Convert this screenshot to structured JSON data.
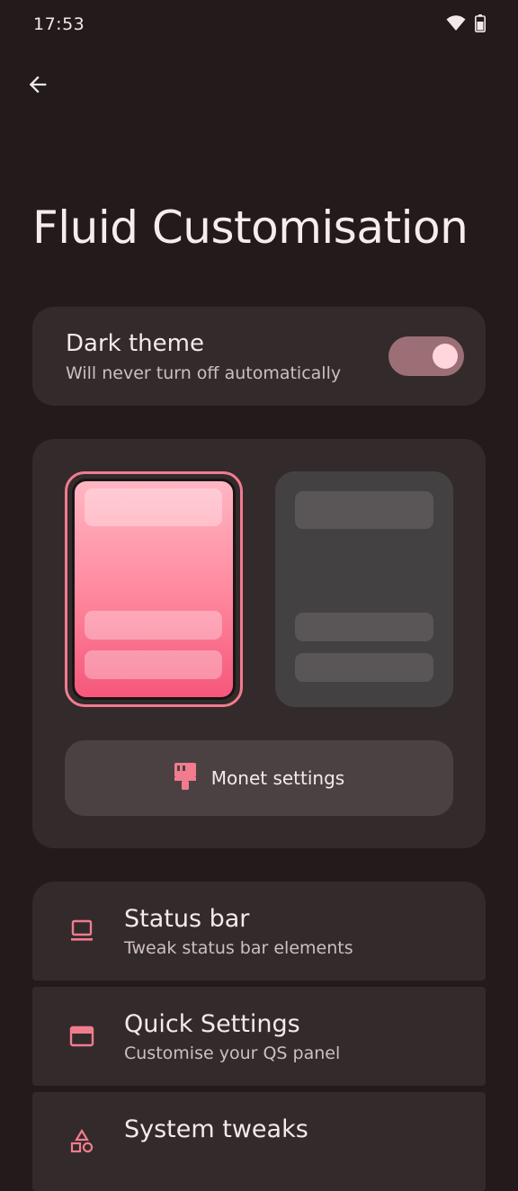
{
  "status_bar": {
    "time": "17:53",
    "icons": [
      "wifi-icon",
      "battery-icon"
    ]
  },
  "header": {
    "back_icon": "arrow-back-icon",
    "title": "Fluid Customisation"
  },
  "dark_theme": {
    "title": "Dark theme",
    "subtitle": "Will never turn off automatically",
    "enabled": true
  },
  "theme_preview": {
    "options": [
      "light-pink",
      "dark-gray"
    ],
    "selected": "light-pink",
    "monet_button": {
      "label": "Monet settings",
      "icon": "paint-brush-icon"
    }
  },
  "settings_list": [
    {
      "title": "Status bar",
      "subtitle": "Tweak status bar elements",
      "icon": "laptop-icon"
    },
    {
      "title": "Quick Settings",
      "subtitle": "Customise your QS panel",
      "icon": "browser-window-icon"
    },
    {
      "title": "System tweaks",
      "subtitle": "",
      "icon": "shapes-icon"
    }
  ],
  "colors": {
    "background": "#221a1b",
    "card": "#332a2b",
    "accent": "#f07c8e",
    "toggle_track": "#9c6f76",
    "toggle_knob": "#ffd6dc"
  }
}
